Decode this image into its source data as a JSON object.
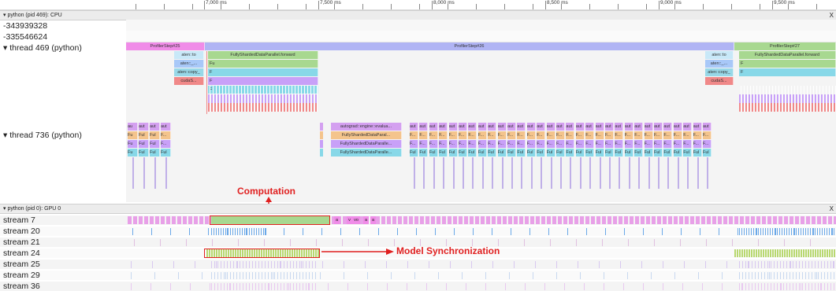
{
  "ruler": {
    "ticks": [
      "7,000 ms",
      "7,500 ms",
      "8,000 ms",
      "8,500 ms",
      "9,000 ms",
      "9,500 ms"
    ]
  },
  "cpu_section": {
    "title": "python (pid 469): CPU",
    "close": "X"
  },
  "gpu_section": {
    "title": "python (pid 0): GPU 0",
    "close": "X"
  },
  "cpu_rows": [
    "-343939328",
    "-335546624",
    "thread 469 (python)",
    "thread 736 (python)"
  ],
  "thread469": {
    "profiler_steps": [
      "ProfilerStep#25",
      "ProfilerStep#26",
      "ProfilerStep#27"
    ],
    "forward": "FullyShardedDataParallel.forward",
    "left_stack": [
      "aten::to",
      "aten::_...",
      "aten::copy_",
      "cudaS..."
    ],
    "left_fwd_children": [
      "Fu",
      "F",
      "F",
      "F"
    ],
    "right_stack": [
      "aten::to",
      "aten::_...",
      "aten::copy_",
      "cudaS..."
    ],
    "right_fwd_children": [
      "F",
      "F"
    ]
  },
  "thread736": {
    "left_cols": [
      [
        "au",
        "Fu",
        "Fu",
        "Fu"
      ],
      [
        "aut",
        "Ful",
        "Ful",
        "Ful"
      ],
      [
        "aut",
        "Ful",
        "Ful",
        "Ful"
      ],
      [
        "aut",
        "F...",
        "F...",
        "Ful"
      ]
    ],
    "mid_stack": [
      "autograd::engine::evalua...",
      "FullyShardedDataParal...",
      "FullyShardedDataParalle...",
      "FullyShardedDataParalle..."
    ],
    "right_top": "aut",
    "right_rows": [
      "F...",
      "F...",
      "Ful"
    ]
  },
  "gpu_rows": [
    "stream 7",
    "stream 20",
    "stream 21",
    "stream 24",
    "stream 25",
    "stream 29",
    "stream 36"
  ],
  "stream7_labels": [
    "a",
    "v",
    "vo",
    "a",
    "a"
  ],
  "annotations": {
    "computation": "Computation",
    "sync": "Model Synchronization"
  },
  "colors": {
    "step": "#f08ce8",
    "step26": "#b0b4f4",
    "forward": "#a8d890",
    "autograd": "#d4a0f0",
    "orange": "#f4c48c",
    "purple": "#c8a0f8",
    "cyan": "#88d8e8",
    "pink": "#f08888",
    "annot": "#e02020"
  }
}
